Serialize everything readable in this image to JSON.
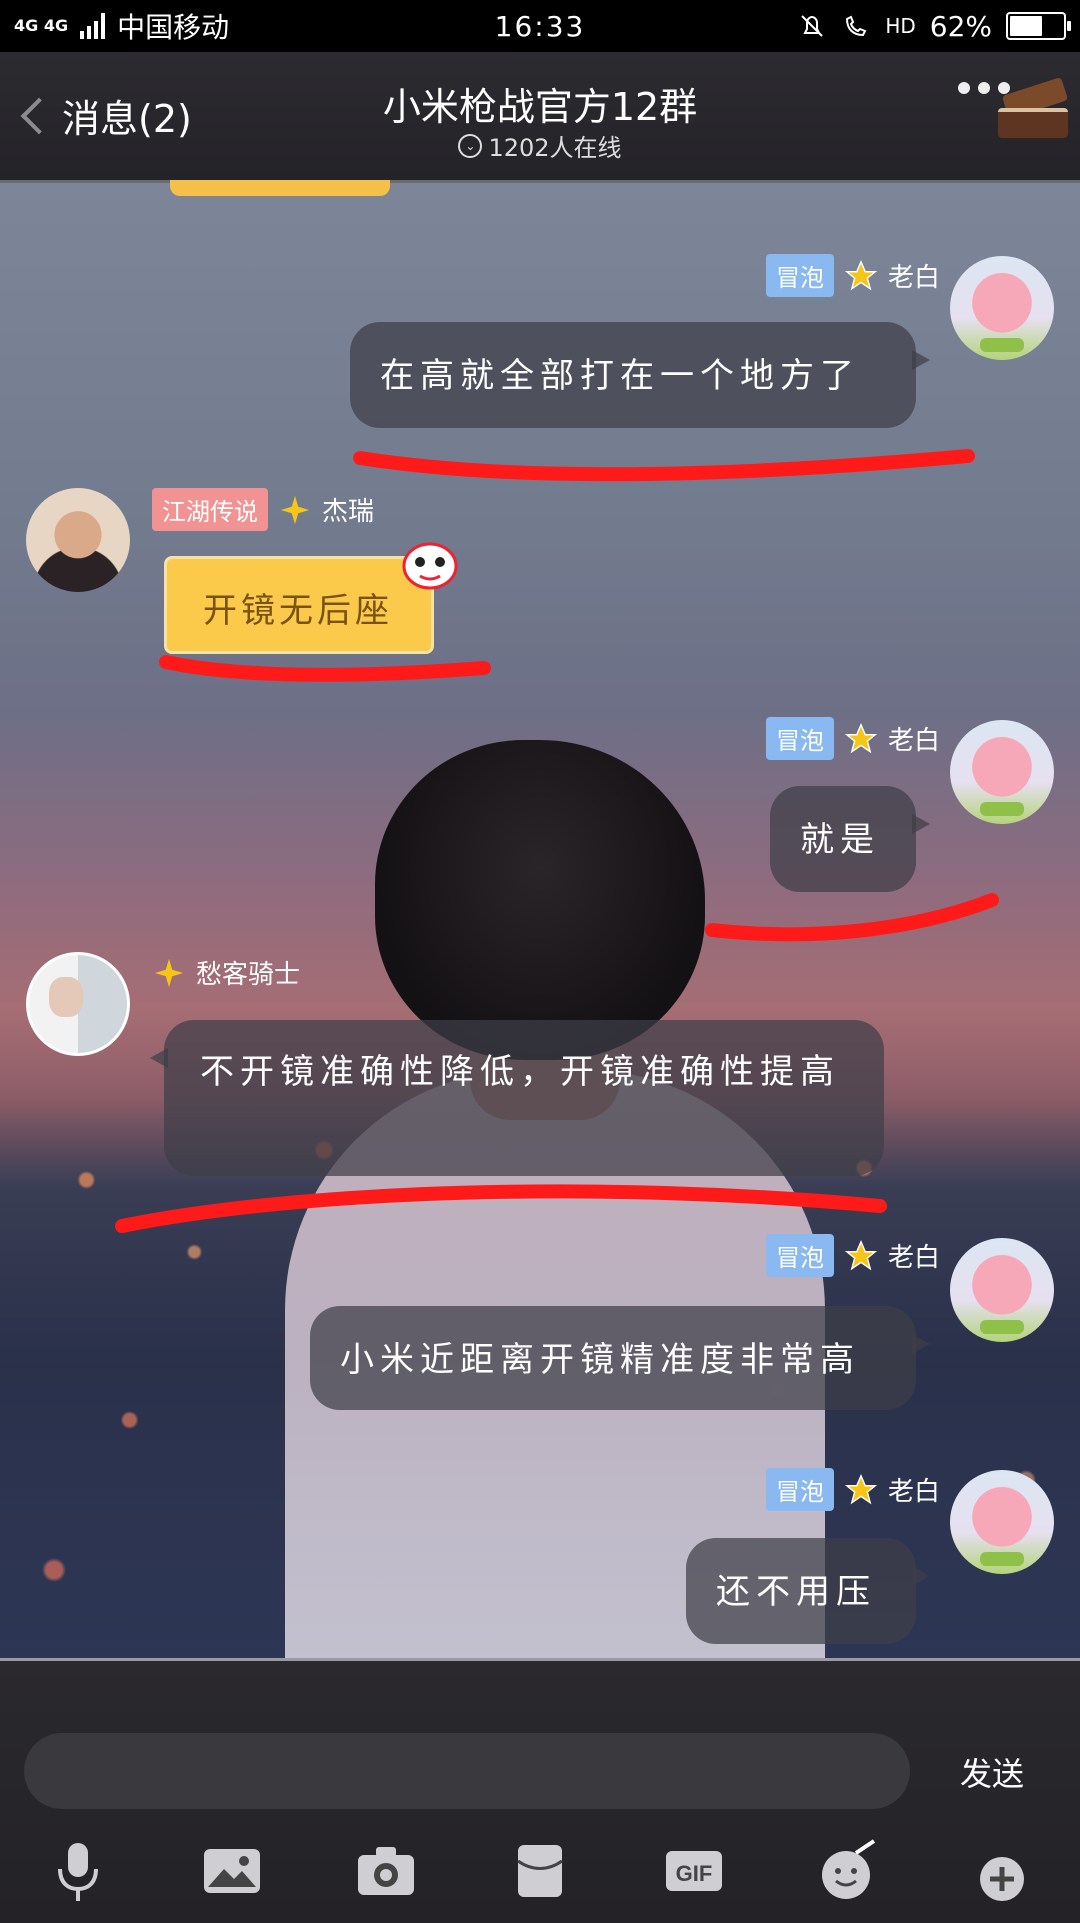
{
  "status_bar": {
    "network": "4G 4G",
    "carrier": "中国移动",
    "time": "16:33",
    "hd": "HD",
    "battery": "62%",
    "battery_level": 0.62
  },
  "header": {
    "back_label": "消息(2)",
    "title": "小米枪战官方12群",
    "online": "1202人在线"
  },
  "messages": [
    {
      "side": "right",
      "badge": "冒泡",
      "name": "老白",
      "text": "在高就全部打在一个地方了"
    },
    {
      "side": "left",
      "badge": "江湖传说",
      "name": "杰瑞",
      "text": "开镜无后座"
    },
    {
      "side": "right",
      "badge": "冒泡",
      "name": "老白",
      "text": "就是"
    },
    {
      "side": "left",
      "badge": "",
      "name": "愁客骑士",
      "text": "不开镜准确性降低，开镜准确性提高"
    },
    {
      "side": "right",
      "badge": "冒泡",
      "name": "老白",
      "text": "小米近距离开镜精准度非常高"
    },
    {
      "side": "right",
      "badge": "冒泡",
      "name": "老白",
      "text": "还不用压"
    }
  ],
  "composer": {
    "input_value": "",
    "send_label": "发送"
  },
  "toolbar_icons": [
    "microphone-icon",
    "image-icon",
    "camera-icon",
    "red-packet-icon",
    "gif-icon",
    "emoji-icon",
    "plus-icon"
  ],
  "colors": {
    "accent_blue_badge": "#8ab8f0",
    "pink_badge": "#f19393",
    "yellow_bubble": "#fcca4a",
    "annotation_red": "#ff1a1a"
  }
}
